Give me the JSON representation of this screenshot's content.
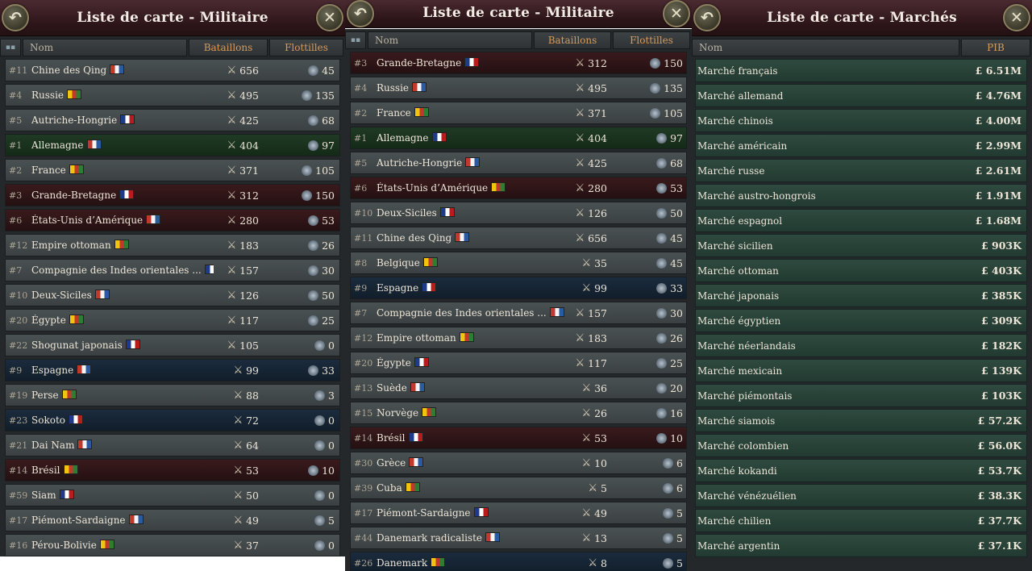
{
  "panels": [
    {
      "title": "Liste de carte - Militaire",
      "cols": {
        "name": "Nom",
        "bat": "Bataillons",
        "flo": "Flottilles"
      },
      "rows": [
        {
          "rank": "#11",
          "name": "Chine des Qing",
          "bat": "656",
          "flo": "45",
          "hl": ""
        },
        {
          "rank": "#4",
          "name": "Russie",
          "bat": "495",
          "flo": "135",
          "hl": ""
        },
        {
          "rank": "#5",
          "name": "Autriche-Hongrie",
          "bat": "425",
          "flo": "68",
          "hl": ""
        },
        {
          "rank": "#1",
          "name": "Allemagne",
          "bat": "404",
          "flo": "97",
          "hl": "green"
        },
        {
          "rank": "#2",
          "name": "France",
          "bat": "371",
          "flo": "105",
          "hl": ""
        },
        {
          "rank": "#3",
          "name": "Grande-Bretagne",
          "bat": "312",
          "flo": "150",
          "hl": "red"
        },
        {
          "rank": "#6",
          "name": "États-Unis d’Amérique",
          "bat": "280",
          "flo": "53",
          "hl": "red"
        },
        {
          "rank": "#12",
          "name": "Empire ottoman",
          "bat": "183",
          "flo": "26",
          "hl": ""
        },
        {
          "rank": "#7",
          "name": "Compagnie des Indes orientales ...",
          "bat": "157",
          "flo": "30",
          "hl": ""
        },
        {
          "rank": "#10",
          "name": "Deux-Siciles",
          "bat": "126",
          "flo": "50",
          "hl": ""
        },
        {
          "rank": "#20",
          "name": "Égypte",
          "bat": "117",
          "flo": "25",
          "hl": ""
        },
        {
          "rank": "#22",
          "name": "Shogunat japonais",
          "bat": "105",
          "flo": "0",
          "hl": ""
        },
        {
          "rank": "#9",
          "name": "Espagne",
          "bat": "99",
          "flo": "33",
          "hl": "blue"
        },
        {
          "rank": "#19",
          "name": "Perse",
          "bat": "88",
          "flo": "3",
          "hl": ""
        },
        {
          "rank": "#23",
          "name": "Sokoto",
          "bat": "72",
          "flo": "0",
          "hl": "blue"
        },
        {
          "rank": "#21",
          "name": "Dai Nam",
          "bat": "64",
          "flo": "0",
          "hl": ""
        },
        {
          "rank": "#14",
          "name": "Brésil",
          "bat": "53",
          "flo": "10",
          "hl": "red"
        },
        {
          "rank": "#59",
          "name": "Siam",
          "bat": "50",
          "flo": "0",
          "hl": ""
        },
        {
          "rank": "#17",
          "name": "Piémont-Sardaigne",
          "bat": "49",
          "flo": "5",
          "hl": ""
        },
        {
          "rank": "#16",
          "name": "Pérou-Bolivie",
          "bat": "37",
          "flo": "0",
          "hl": ""
        }
      ]
    },
    {
      "title": "Liste de carte - Militaire",
      "cols": {
        "name": "Nom",
        "bat": "Bataillons",
        "flo": "Flottilles"
      },
      "rows": [
        {
          "rank": "#3",
          "name": "Grande-Bretagne",
          "bat": "312",
          "flo": "150",
          "hl": "red"
        },
        {
          "rank": "#4",
          "name": "Russie",
          "bat": "495",
          "flo": "135",
          "hl": ""
        },
        {
          "rank": "#2",
          "name": "France",
          "bat": "371",
          "flo": "105",
          "hl": ""
        },
        {
          "rank": "#1",
          "name": "Allemagne",
          "bat": "404",
          "flo": "97",
          "hl": "green"
        },
        {
          "rank": "#5",
          "name": "Autriche-Hongrie",
          "bat": "425",
          "flo": "68",
          "hl": ""
        },
        {
          "rank": "#6",
          "name": "États-Unis d’Amérique",
          "bat": "280",
          "flo": "53",
          "hl": "red"
        },
        {
          "rank": "#10",
          "name": "Deux-Siciles",
          "bat": "126",
          "flo": "50",
          "hl": ""
        },
        {
          "rank": "#11",
          "name": "Chine des Qing",
          "bat": "656",
          "flo": "45",
          "hl": ""
        },
        {
          "rank": "#8",
          "name": "Belgique",
          "bat": "35",
          "flo": "45",
          "hl": ""
        },
        {
          "rank": "#9",
          "name": "Espagne",
          "bat": "99",
          "flo": "33",
          "hl": "blue"
        },
        {
          "rank": "#7",
          "name": "Compagnie des Indes orientales ...",
          "bat": "157",
          "flo": "30",
          "hl": ""
        },
        {
          "rank": "#12",
          "name": "Empire ottoman",
          "bat": "183",
          "flo": "26",
          "hl": ""
        },
        {
          "rank": "#20",
          "name": "Égypte",
          "bat": "117",
          "flo": "25",
          "hl": ""
        },
        {
          "rank": "#13",
          "name": "Suède",
          "bat": "36",
          "flo": "20",
          "hl": ""
        },
        {
          "rank": "#15",
          "name": "Norvège",
          "bat": "26",
          "flo": "16",
          "hl": ""
        },
        {
          "rank": "#14",
          "name": "Brésil",
          "bat": "53",
          "flo": "10",
          "hl": "red"
        },
        {
          "rank": "#30",
          "name": "Grèce",
          "bat": "10",
          "flo": "6",
          "hl": ""
        },
        {
          "rank": "#39",
          "name": "Cuba",
          "bat": "5",
          "flo": "6",
          "hl": ""
        },
        {
          "rank": "#17",
          "name": "Piémont-Sardaigne",
          "bat": "49",
          "flo": "5",
          "hl": ""
        },
        {
          "rank": "#44",
          "name": "Danemark radicaliste",
          "bat": "13",
          "flo": "5",
          "hl": ""
        },
        {
          "rank": "#26",
          "name": "Danemark",
          "bat": "8",
          "flo": "5",
          "hl": "blue"
        }
      ]
    }
  ],
  "markets": {
    "title": "Liste de carte - Marchés",
    "cols": {
      "name": "Nom",
      "gdp": "PIB"
    },
    "rows": [
      {
        "name": "Marché français",
        "gdp": "£ 6.51M"
      },
      {
        "name": "Marché allemand",
        "gdp": "£ 4.76M"
      },
      {
        "name": "Marché chinois",
        "gdp": "£ 4.00M"
      },
      {
        "name": "Marché américain",
        "gdp": "£ 2.99M"
      },
      {
        "name": "Marché russe",
        "gdp": "£ 2.61M"
      },
      {
        "name": "Marché austro-hongrois",
        "gdp": "£ 1.91M"
      },
      {
        "name": "Marché espagnol",
        "gdp": "£ 1.68M"
      },
      {
        "name": "Marché sicilien",
        "gdp": "£ 903K"
      },
      {
        "name": "Marché ottoman",
        "gdp": "£ 403K"
      },
      {
        "name": "Marché japonais",
        "gdp": "£ 385K"
      },
      {
        "name": "Marché égyptien",
        "gdp": "£ 309K"
      },
      {
        "name": "Marché néerlandais",
        "gdp": "£ 182K"
      },
      {
        "name": "Marché mexicain",
        "gdp": "£ 139K"
      },
      {
        "name": "Marché piémontais",
        "gdp": "£ 103K"
      },
      {
        "name": "Marché siamois",
        "gdp": "£ 57.2K"
      },
      {
        "name": "Marché colombien",
        "gdp": "£ 56.0K"
      },
      {
        "name": "Marché kokandi",
        "gdp": "£ 53.7K"
      },
      {
        "name": "Marché vénézuélien",
        "gdp": "£ 38.3K"
      },
      {
        "name": "Marché chilien",
        "gdp": "£ 37.7K"
      },
      {
        "name": "Marché argentin",
        "gdp": "£ 37.1K"
      }
    ]
  },
  "icons": {
    "back": "back-arrow-icon",
    "close": "close-icon",
    "battalion": "battalion-icon",
    "flotilla": "flotilla-icon",
    "flag": "flag-icon"
  },
  "colors": {
    "title_bg": "#2c1519",
    "row_bg": "#3b4143",
    "market_row_bg": "#223a31",
    "header_accent": "#d99a5a",
    "ally_green": "#142a18",
    "rival_red": "#241012",
    "neutral_blue": "#111d2a"
  }
}
